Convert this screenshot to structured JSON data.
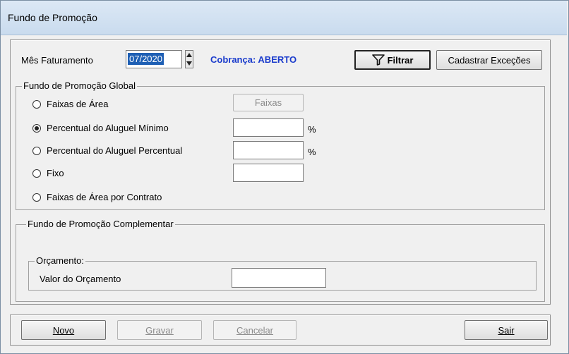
{
  "window": {
    "title": "Fundo de Promoção"
  },
  "header": {
    "mes_label": "Mês Faturamento",
    "mes_value": "07/2020",
    "cobranca": "Cobrança: ABERTO",
    "filtrar_label": "Filtrar",
    "cadastrar_label": "Cadastrar Exceções"
  },
  "global": {
    "legend": "Fundo de Promoção Global",
    "options": [
      {
        "label": "Faixas de Área",
        "checked": false
      },
      {
        "label": "Percentual do Aluguel Mínimo",
        "checked": true
      },
      {
        "label": "Percentual do Aluguel Percentual",
        "checked": false
      },
      {
        "label": "Fixo",
        "checked": false
      },
      {
        "label": "Faixas de Área por Contrato",
        "checked": false
      }
    ],
    "faixas_button": "Faixas",
    "pct_symbol": "%",
    "pct_minimo_value": "",
    "pct_percentual_value": "",
    "fixo_value": ""
  },
  "complementar": {
    "legend": "Fundo de Promoção Complementar",
    "orcamento_legend": "Orçamento:",
    "valor_label": "Valor do Orçamento",
    "valor_value": ""
  },
  "footer": {
    "novo": "Novo",
    "gravar": "Gravar",
    "cancelar": "Cancelar",
    "sair": "Sair"
  }
}
